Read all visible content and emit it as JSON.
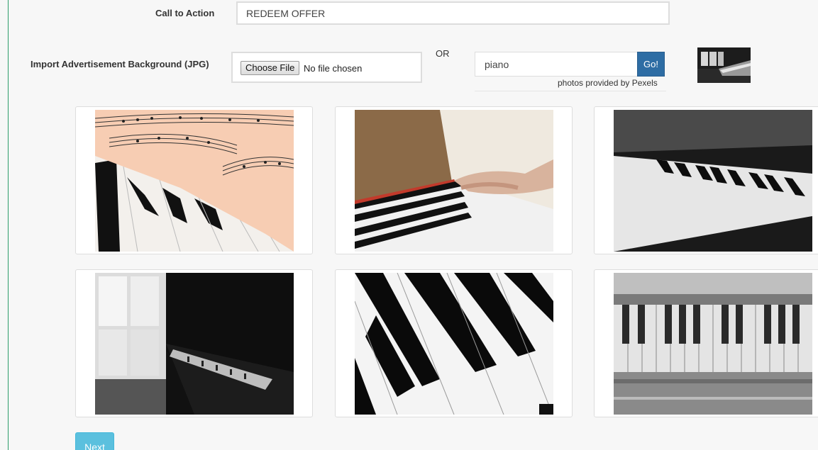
{
  "form": {
    "cta_label": "Call to Action",
    "cta_value": "REDEEM OFFER",
    "import_label": "Import Advertisement Background (JPG)",
    "choose_file_label": "Choose File",
    "file_status": "No file chosen",
    "or_label": "OR",
    "search_value": "piano",
    "go_label": "Go!",
    "credit": "photos provided by Pexels"
  },
  "selected_preview": {
    "icon": "piano-photo-thumbnail"
  },
  "results": [
    {
      "icon": "sheet-music-piano-photo"
    },
    {
      "icon": "hands-playing-piano-photo"
    },
    {
      "icon": "grayscale-keyboard-photo"
    },
    {
      "icon": "grand-piano-window-photo"
    },
    {
      "icon": "closeup-piano-keys-photo"
    },
    {
      "icon": "vintage-piano-keys-photo"
    }
  ],
  "actions": {
    "next_label": "Next"
  },
  "colors": {
    "go_button": "#2e6da4",
    "next_button": "#5bc0de",
    "left_rule": "#2e9e6a"
  }
}
